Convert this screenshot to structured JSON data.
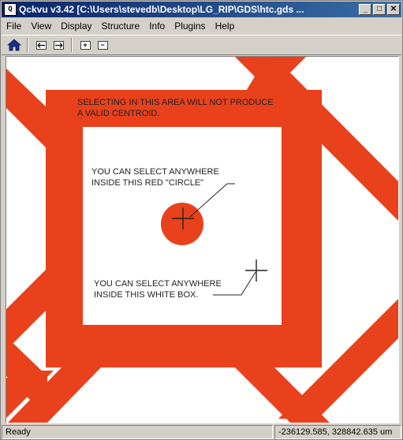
{
  "window": {
    "title": "Qckvu v3.42 [C:\\Users\\stevedb\\Desktop\\LG_RIP\\GDS\\htc.gds ...",
    "icon_label": "Q",
    "controls": {
      "minimize": "_",
      "maximize": "□",
      "close": "✕"
    }
  },
  "menubar": {
    "items": [
      {
        "label": "File"
      },
      {
        "label": "View"
      },
      {
        "label": "Display"
      },
      {
        "label": "Structure"
      },
      {
        "label": "Info"
      },
      {
        "label": "Plugins"
      },
      {
        "label": "Help"
      }
    ]
  },
  "toolbar": {
    "buttons": [
      {
        "icon": "home-icon"
      },
      {
        "icon": "back-icon"
      },
      {
        "icon": "forward-icon"
      },
      {
        "icon": "zoom-in-icon",
        "glyph": "+"
      },
      {
        "icon": "zoom-out-icon",
        "glyph": "−"
      }
    ]
  },
  "canvas": {
    "colors": {
      "shape": "#e8411c",
      "background": "#ffffff",
      "annotation": "#222222"
    },
    "annotations": {
      "warning_line1": "SELECTING IN THIS AREA WILL NOT  PRODUCE",
      "warning_line2": "A VALID CENTROID.",
      "circle_line1": "YOU CAN SELECT ANYWHERE",
      "circle_line2": "INSIDE THIS RED \"CIRCLE\"",
      "box_line1": "YOU CAN SELECT ANYWHERE",
      "box_line2": "INSIDE THIS WHITE BOX."
    }
  },
  "statusbar": {
    "left": "Ready",
    "right": "-236129.585, 328842.635 um"
  }
}
